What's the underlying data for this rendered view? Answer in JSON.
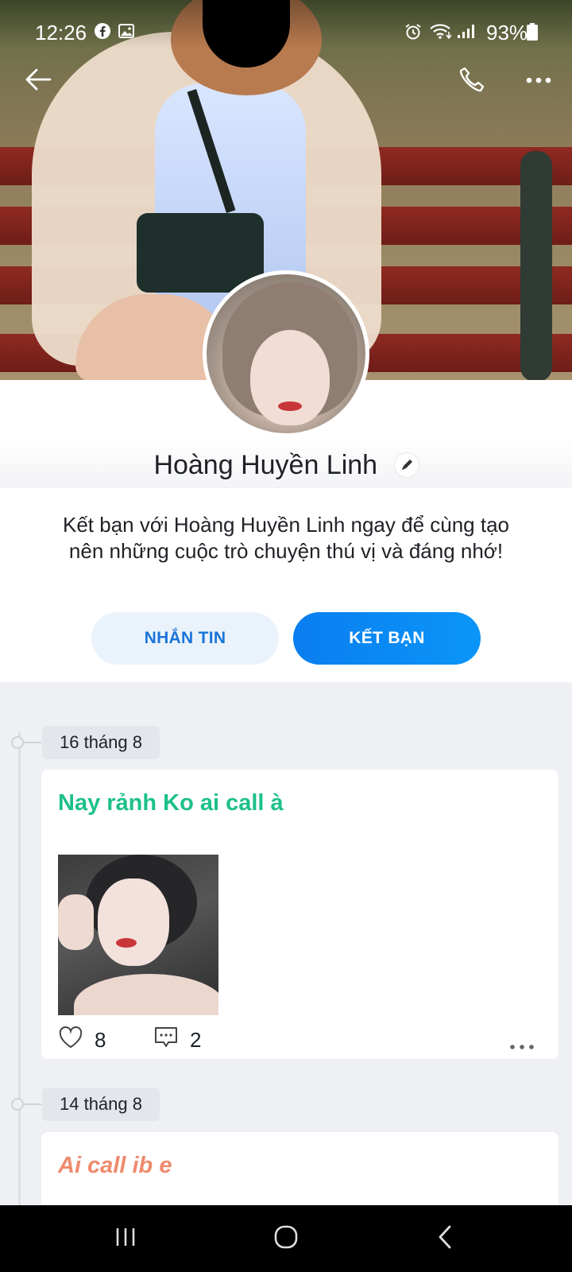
{
  "status_bar": {
    "time": "12:26",
    "battery": "93%"
  },
  "profile": {
    "name": "Hoàng Huyền Linh",
    "intro": "Kết bạn với Hoàng Huyền Linh ngay để cùng tạo nên những cuộc trò chuyện thú vị và đáng nhớ!",
    "message_button": "NHẮN TIN",
    "add_friend_button": "KẾT BẠN"
  },
  "timeline": [
    {
      "date": "16 tháng 8",
      "title": "Nay rảnh Ko ai call à",
      "likes": "8",
      "comments": "2"
    },
    {
      "date": "14 tháng 8",
      "title": "Ai call ib e"
    }
  ],
  "colors": {
    "accent_blue": "#0a84f5",
    "post1_title": "#1ec08a",
    "post2_title": "#ee8a6d"
  },
  "icons": {
    "nav": [
      "back-arrow-icon",
      "phone-icon",
      "more-icon"
    ],
    "status": [
      "facebook-icon",
      "gallery-icon",
      "alarm-icon",
      "wifi-icon",
      "signal-icon",
      "battery-icon"
    ],
    "system_nav": [
      "recents-icon",
      "home-icon",
      "back-icon"
    ]
  }
}
